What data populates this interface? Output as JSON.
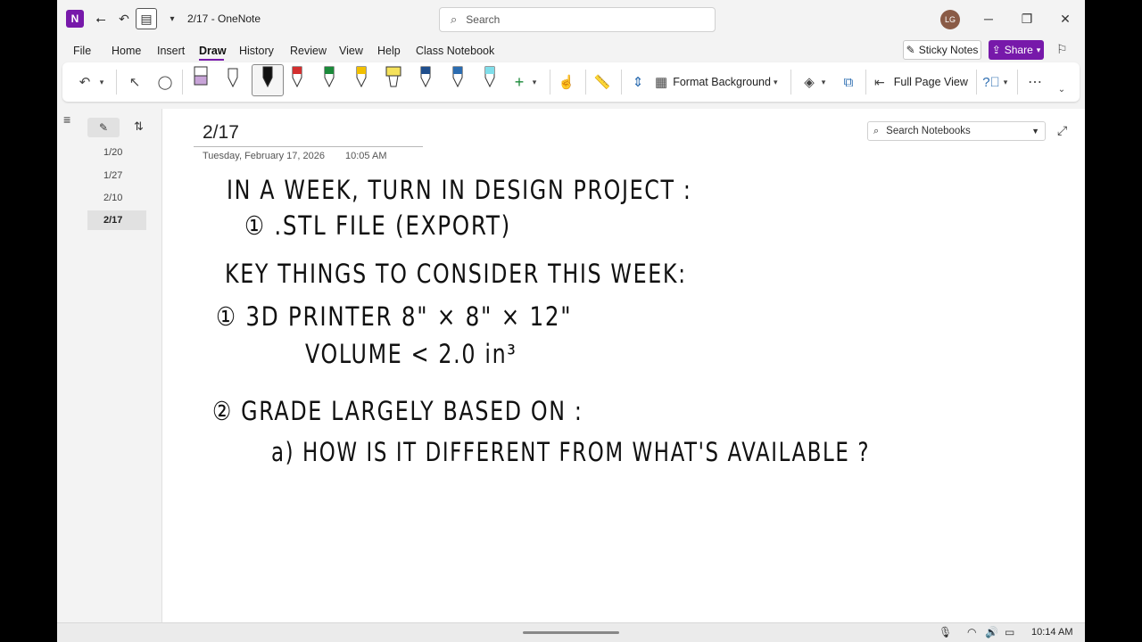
{
  "titlebar": {
    "app_icon": "onenote-logo",
    "title": "2/17  -  OneNote",
    "search_placeholder": "Search",
    "avatar_initials": "LG"
  },
  "menu": {
    "items": [
      "File",
      "Home",
      "Insert",
      "Draw",
      "History",
      "Review",
      "View",
      "Help",
      "Class Notebook"
    ],
    "active": "Draw",
    "sticky_notes": "Sticky Notes",
    "share": "Share"
  },
  "ribbon": {
    "pen_colors": [
      "#8e7cc3",
      "#ffffff",
      "#111111",
      "#d32f2f",
      "#1b8a3a",
      "#f2c000",
      "#f5e25b",
      "#1f4e8c",
      "#2b6cb0",
      "#80deea"
    ],
    "format_background": "Format Background",
    "full_page_view": "Full Page View"
  },
  "pages": {
    "items": [
      "1/20",
      "1/27",
      "2/10",
      "2/17"
    ],
    "selected": "2/17"
  },
  "page": {
    "title": "2/17",
    "date": "Tuesday, February 17, 2026",
    "time": "10:05 AM",
    "search_notebooks": "Search Notebooks"
  },
  "ink": {
    "line1": "IN  A  WEEK,  TURN  IN  DESIGN  PROJECT :",
    "line2": "①   .STL   FILE    (EXPORT)",
    "line3": "KEY  THINGS  TO  CONSIDER  THIS  WEEK:",
    "line4": "①   3D  PRINTER    8\" × 8\" × 12\"",
    "line5": "VOLUME  <  2.0 in³",
    "line6": "②    GRADE  LARGELY  BASED   ON :",
    "line7": "a)   HOW  IS  IT  DIFFERENT  FROM  WHAT'S  AVAILABLE ?"
  },
  "taskbar": {
    "clock": "10:14 AM"
  }
}
